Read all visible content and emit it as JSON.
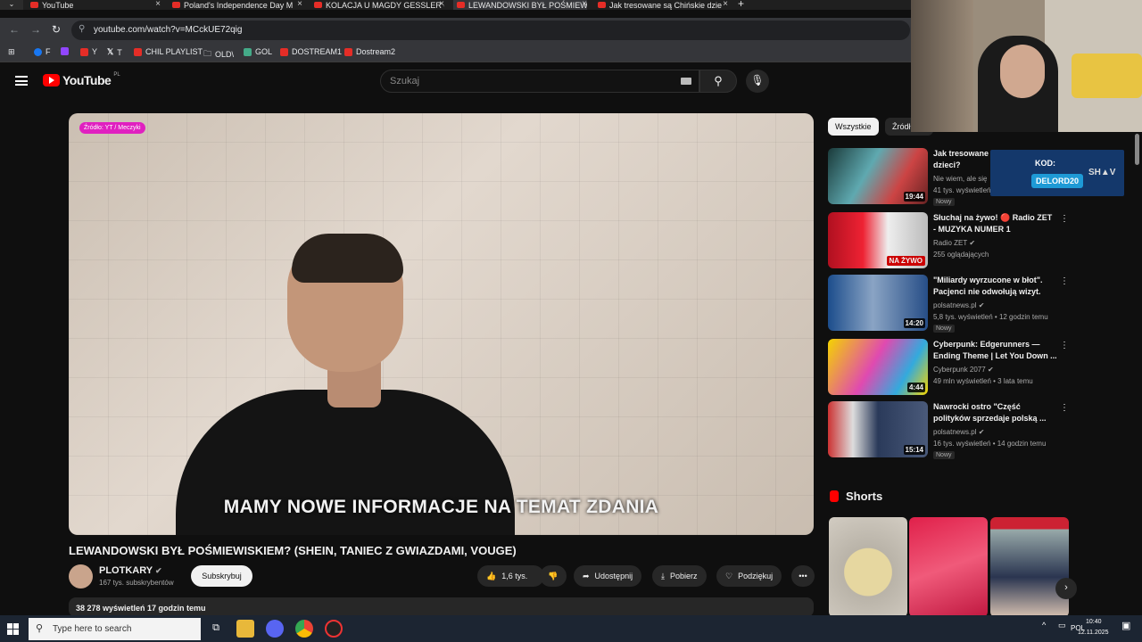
{
  "browser": {
    "tabs": [
      {
        "label": "YouTube",
        "active": false
      },
      {
        "label": "Poland's Independence Day M",
        "active": false
      },
      {
        "label": "KOLACJA U MAGDY GESSLER c",
        "active": false
      },
      {
        "label": "LEWANDOWSKI BYŁ POŚMIEW",
        "active": true
      },
      {
        "label": "Jak tresowane są Chińskie dzie",
        "active": false
      }
    ],
    "url": "youtube.com/watch?v=MCckUE72qig",
    "bookmarks": [
      "F",
      "Y",
      "T",
      "CHIL PLAYLIST",
      "OLD\\",
      "GOL",
      "DOSTREAM1",
      "Dostream2"
    ]
  },
  "youtube": {
    "logo_text": "YouTube",
    "logo_country": "PL",
    "search_placeholder": "Szukaj"
  },
  "video": {
    "source_tag": "Źródło: YT / Meczyki",
    "subtitle": "MAMY NOWE INFORMACJE NA TEMAT ZDANIA",
    "title": "LEWANDOWSKI BYŁ POŚMIEWISKIEM? (SHEIN, TANIEC Z GWIAZDAMI, VOUGE)",
    "channel": "PLOTKARY",
    "subscribers": "167 tys. subskrybentów",
    "subscribe_label": "Subskrybuj",
    "likes": "1,6 tys.",
    "share_label": "Udostępnij",
    "download_label": "Pobierz",
    "thanks_label": "Podziękuj",
    "views_time": "38 278 wyświetleń  17 godzin temu"
  },
  "chips": [
    "Wszystkie",
    "Źródł"
  ],
  "recommended": [
    {
      "title": "Jak tresowane\ndzieci?",
      "channel": "Nie wiem, ale się",
      "meta": "41 tys. wyświetleń",
      "badge": "Nowy",
      "duration": "19:44"
    },
    {
      "title": "Słuchaj na żywo! 🔴 Radio ZET\n- MUZYKA NUMER 1",
      "channel": "Radio ZET",
      "meta": "255 oglądających",
      "badge": "",
      "duration": "NA ŻYWO"
    },
    {
      "title": "\"Miliardy wyrzucone w błot\".\nPacjenci nie odwołują wizyt.",
      "channel": "polsatnews.pl",
      "meta": "5,8 tys. wyświetleń • 12 godzin temu",
      "badge": "Nowy",
      "duration": "14:20"
    },
    {
      "title": "Cyberpunk: Edgerunners —\nEnding Theme | Let You Down ...",
      "channel": "Cyberpunk 2077",
      "meta": "49 mln wyświetleń • 3 lata temu",
      "badge": "",
      "duration": "4:44"
    },
    {
      "title": "Nawrocki ostro \"Część\npolityków sprzedaje polską ...",
      "channel": "polsatnews.pl",
      "meta": "16 tys. wyświetleń • 14 godzin temu",
      "badge": "Nowy",
      "duration": "15:14"
    }
  ],
  "shorts_label": "Shorts",
  "promo": {
    "label": "KOD:",
    "code": "DELORD20",
    "brand": "SH▲V"
  },
  "taskbar": {
    "search_placeholder": "Type here to search",
    "lang": "POL",
    "time": "10:40",
    "date": "12.11.2025"
  }
}
